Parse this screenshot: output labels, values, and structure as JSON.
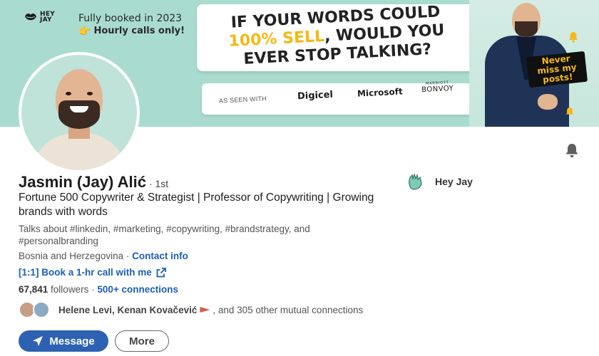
{
  "banner": {
    "brand_text": "HEY\nJAY",
    "promo_line1": "Fully booked in 2023",
    "promo_line2": "Hourly calls only!",
    "headline_pre": "IF YOUR WORDS COULD",
    "headline_highlight": "100% SELL",
    "headline_mid": ", WOULD YOU",
    "headline_end": "EVER STOP TALKING?",
    "seen_with_label": "AS SEEN WITH",
    "logos": [
      "Digicel",
      "Microsoft",
      "BONVOY"
    ],
    "logo_bonvoy_small": "MARRIOTT",
    "sticker_text": "Never miss my posts!",
    "accent_color": "#f5b915",
    "background_color": "#a9dccf"
  },
  "profile": {
    "name": "Jasmin (Jay) Alić",
    "degree": "· 1st",
    "headline": "Fortune 500 Copywriter & Strategist | Professor of Copywriting | Growing brands with words",
    "talks_about": "Talks about #linkedin, #marketing, #copywriting, #brandstrategy, and #personalbranding",
    "location": "Bosnia and Herzegovina",
    "location_separator": " · ",
    "contact_info_label": "Contact info",
    "book_call_label": "[1:1] Book a 1-hr call with me",
    "followers_count": "67,841",
    "followers_label": " followers ",
    "connections_separator": " · ",
    "connections_label": "500+ connections",
    "mutual_names": "Helene Levi, Kenan Kovačević",
    "mutual_rest": ", and 305 other mutual connections"
  },
  "company": {
    "name": "Hey Jay"
  },
  "actions": {
    "message_label": "Message",
    "more_label": "More"
  },
  "icons": {
    "bell": "bell-icon",
    "external_link": "external-link-icon",
    "send": "send-icon",
    "hand": "pointing-hand-icon"
  },
  "colors": {
    "link": "#1d5fb5",
    "primary_button": "#2d62b3"
  }
}
